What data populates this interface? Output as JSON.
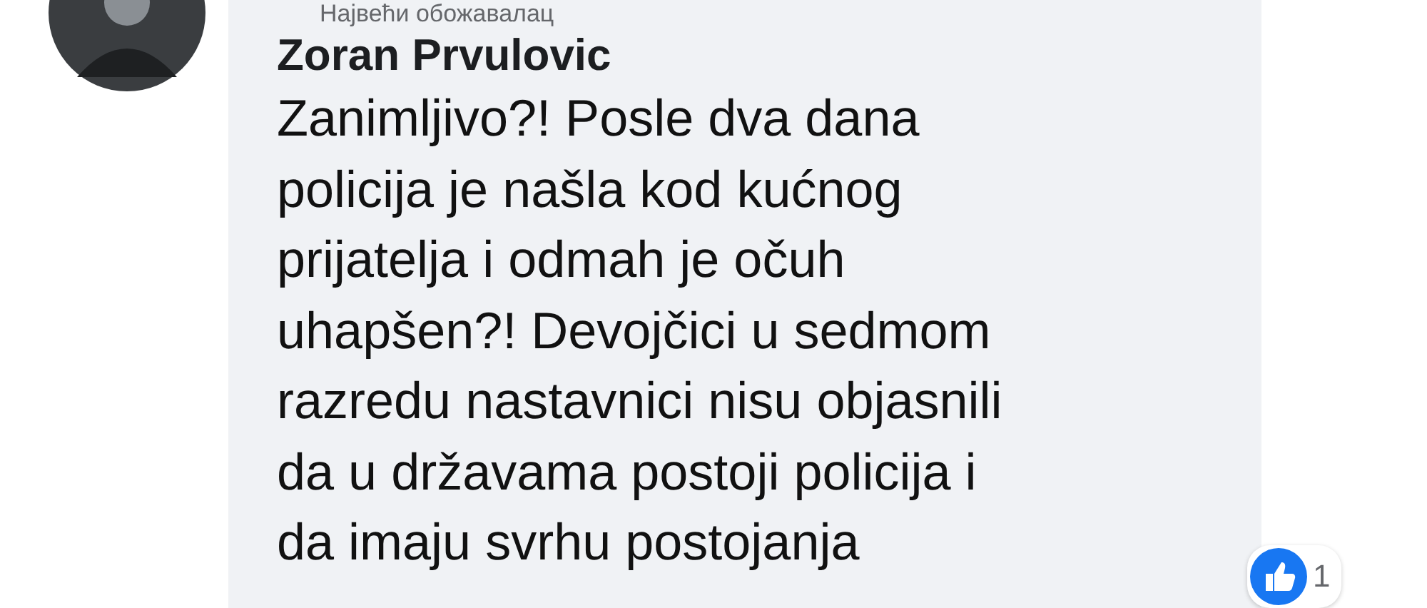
{
  "comment": {
    "badge": "Највећи обожавалац",
    "author": "Zoran Prvulovic",
    "lines": [
      "Zanimljivo?! Posle dva dana",
      "policija je našla kod kućnog",
      "prijatelja i odmah je očuh",
      "uhapšen?! Devojčici u sedmom",
      "razredu nastavnici nisu objasnili",
      "da u državama postoji policija i",
      "da imaju svrhu postojanja"
    ],
    "reactions": {
      "count": "1"
    }
  }
}
